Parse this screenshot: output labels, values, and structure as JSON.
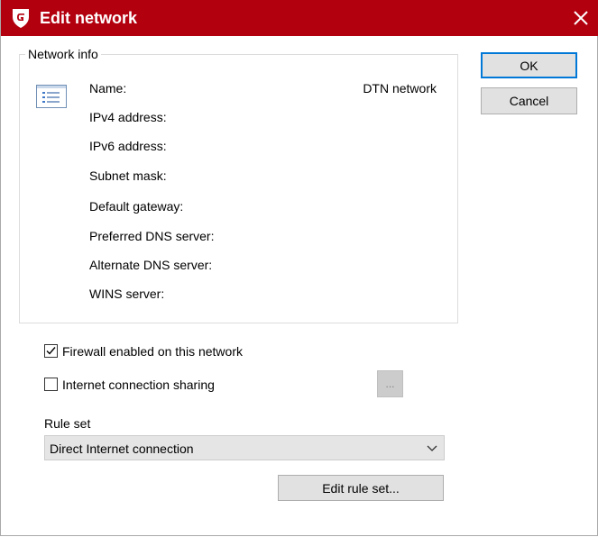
{
  "window": {
    "title": "Edit network",
    "accent_color": "#b3000f",
    "logo_icon": "g-data-shield-icon",
    "close_icon": "close-icon"
  },
  "network_info": {
    "legend": "Network info",
    "icon": "network-list-icon",
    "fields": [
      {
        "label": "Name:",
        "value": "DTN network"
      },
      {
        "label": "IPv4 address:",
        "value": ""
      },
      {
        "label": "IPv6 address:",
        "value": ""
      },
      {
        "label": "Subnet mask:",
        "value": ""
      },
      {
        "label": "Default gateway:",
        "value": ""
      },
      {
        "label": "Preferred DNS server:",
        "value": ""
      },
      {
        "label": "Alternate DNS server:",
        "value": ""
      },
      {
        "label": "WINS server:",
        "value": ""
      }
    ]
  },
  "buttons": {
    "ok": "OK",
    "cancel": "Cancel",
    "ellipsis": "...",
    "edit_rule_set": "Edit rule set..."
  },
  "options": {
    "firewall": {
      "label": "Firewall enabled on this network",
      "checked": true
    },
    "sharing": {
      "label": "Internet connection sharing",
      "checked": false
    }
  },
  "rule_set": {
    "label": "Rule set",
    "selected": "Direct Internet connection"
  }
}
